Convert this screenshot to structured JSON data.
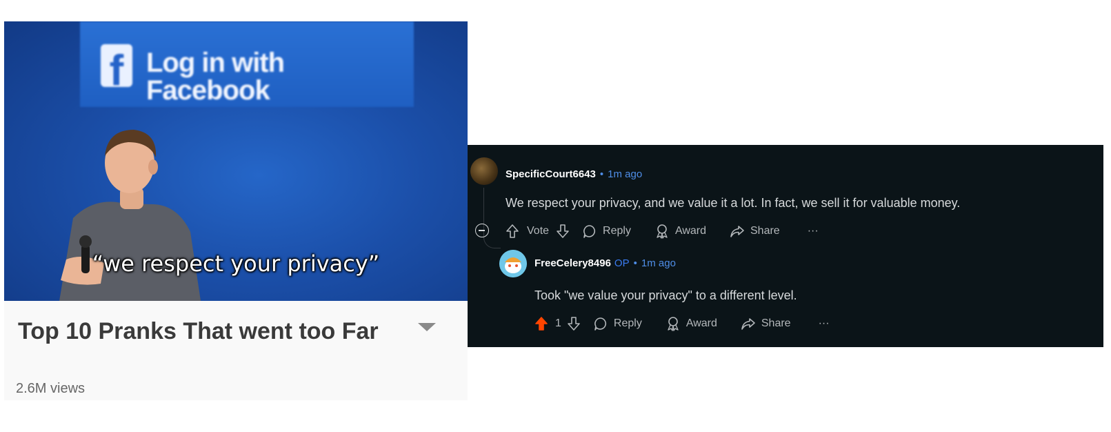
{
  "video": {
    "fb_button_label": "Log in with Facebook",
    "fb_icon_glyph": "f",
    "caption": "“we respect your privacy”",
    "title": "Top 10 Pranks That went too Far",
    "views": "2.6M views"
  },
  "comments": [
    {
      "username": "SpecificCourt6643",
      "separator": "•",
      "time": "1m ago",
      "body": "We respect your privacy, and we value it a lot. In fact, we sell it for valuable money.",
      "actions": {
        "vote": "Vote",
        "reply": "Reply",
        "award": "Award",
        "share": "Share",
        "more": "···"
      }
    },
    {
      "username": "FreeCelery8496",
      "op_badge": "OP",
      "separator": "•",
      "time": "1m ago",
      "body": "Took \"we value your privacy\" to a different level.",
      "actions": {
        "score": "1",
        "reply": "Reply",
        "award": "Award",
        "share": "Share",
        "more": "···"
      }
    }
  ],
  "colors": {
    "panel_bg": "#0b1418",
    "upvote": "#ff4500",
    "op_badge": "#3a7bf0"
  }
}
